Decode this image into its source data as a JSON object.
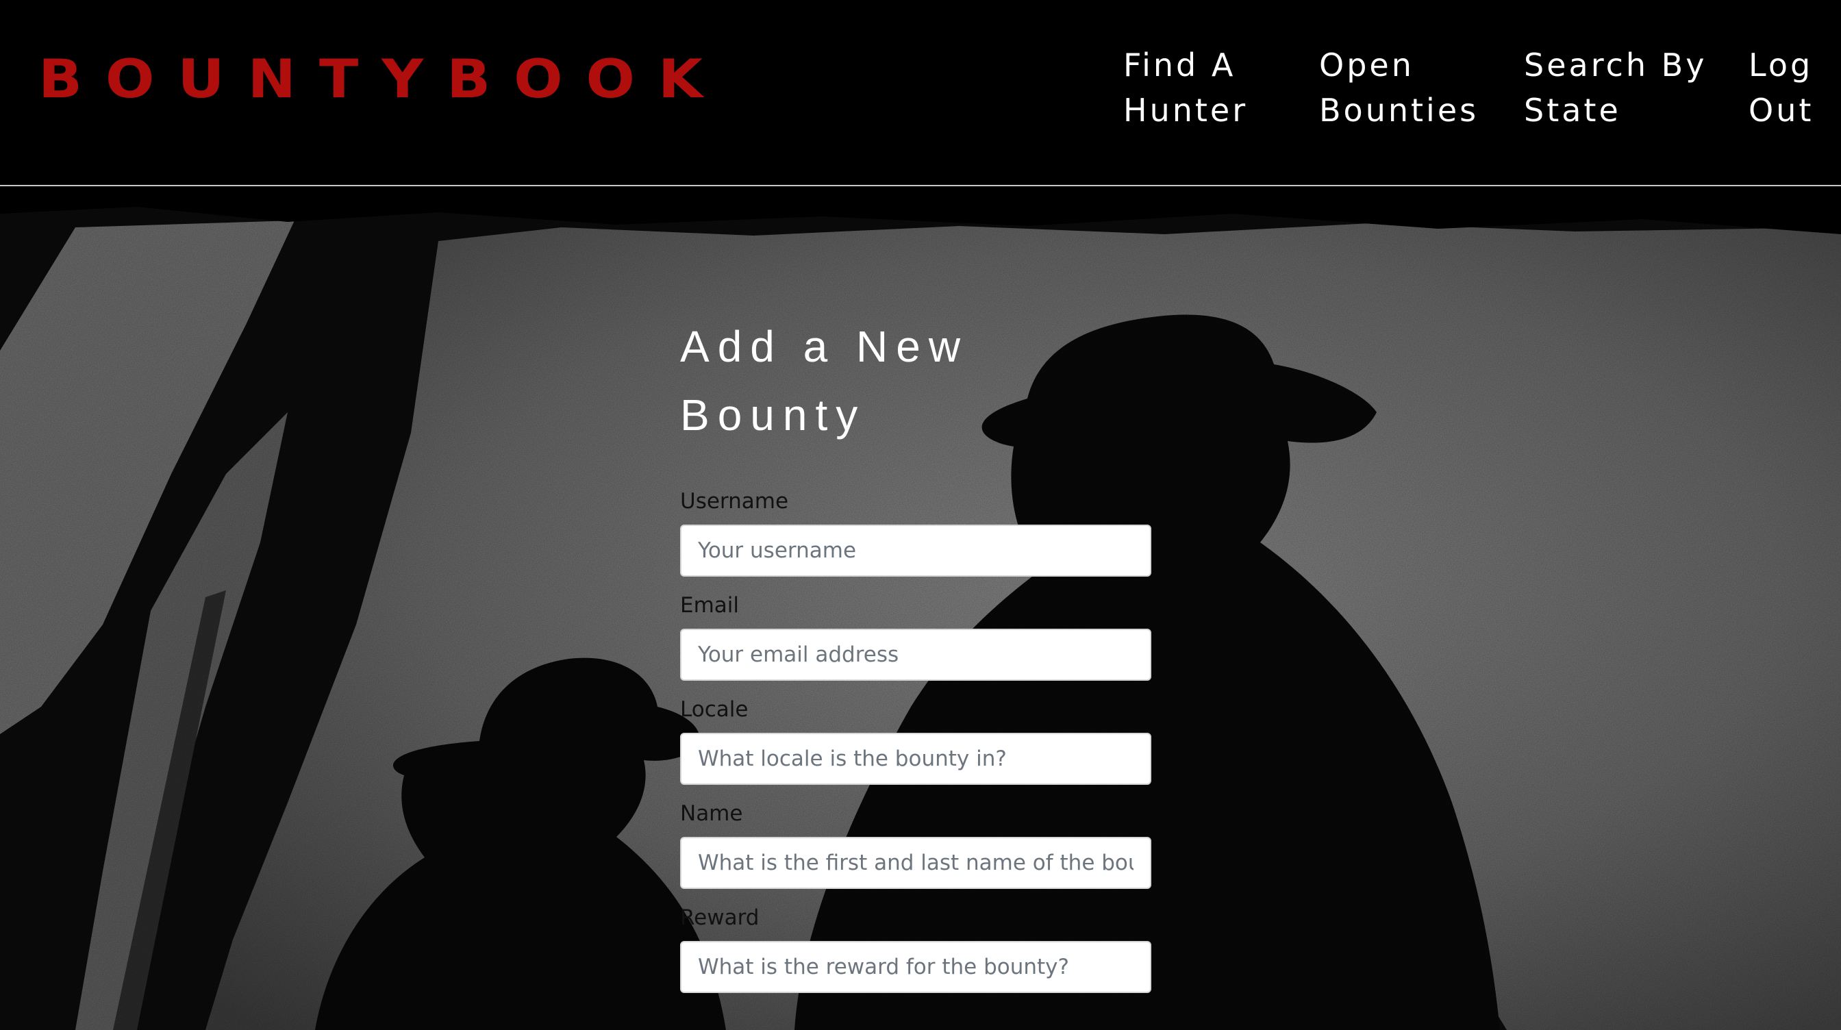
{
  "brand": {
    "name": "BOUNTYBOOK",
    "color": "#b00d0d"
  },
  "nav": {
    "find_hunter": [
      "Find A",
      "Hunter"
    ],
    "open_bounties": [
      "Open",
      "Bounties"
    ],
    "search_state": [
      "Search By",
      "State"
    ],
    "log_out": [
      "Log",
      "Out"
    ]
  },
  "form": {
    "title": "Add a New Bounty",
    "fields": [
      {
        "label": "Username",
        "placeholder": "Your username"
      },
      {
        "label": "Email",
        "placeholder": "Your email address"
      },
      {
        "label": "Locale",
        "placeholder": "What locale is the bounty in?"
      },
      {
        "label": "Name",
        "placeholder": "What is the first and last name of the bounty?"
      },
      {
        "label": "Reward",
        "placeholder": "What is the reward for the bounty?"
      }
    ]
  },
  "icons": {
    "background": "silhouette-hero-image"
  }
}
